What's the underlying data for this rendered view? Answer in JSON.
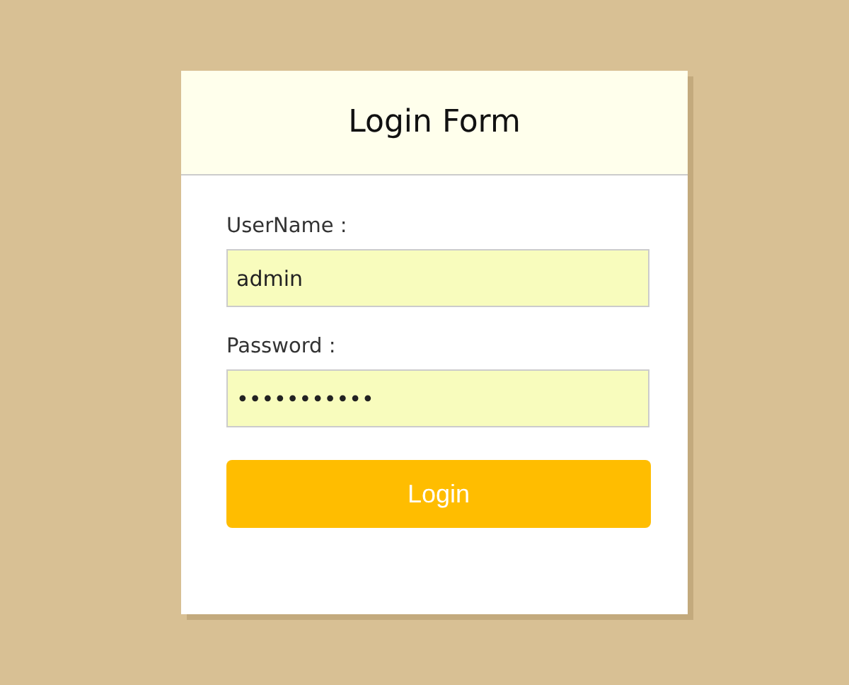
{
  "form": {
    "title": "Login Form",
    "fields": [
      {
        "label": "UserName :",
        "value": "admin"
      },
      {
        "label": "Password :",
        "value": "•••••••••••"
      }
    ],
    "submit": "Login"
  }
}
